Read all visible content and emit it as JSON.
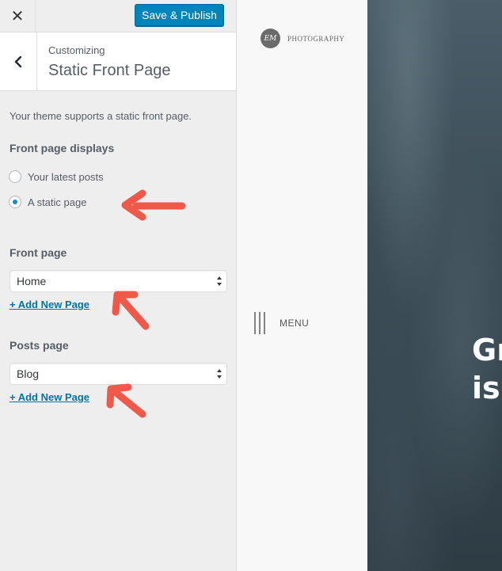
{
  "header": {
    "close_label": "✕",
    "publish_label": "Save & Publish"
  },
  "section": {
    "crumb": "Customizing",
    "title": "Static Front Page"
  },
  "description": "Your theme supports a static front page.",
  "front_page_displays": {
    "title": "Front page displays",
    "options": [
      {
        "label": "Your latest posts",
        "checked": false
      },
      {
        "label": "A static page",
        "checked": true
      }
    ]
  },
  "front_page": {
    "title": "Front page",
    "selected": "Home",
    "add_link": "+ Add New Page"
  },
  "posts_page": {
    "title": "Posts page",
    "selected": "Blog",
    "add_link": "+ Add New Page"
  },
  "preview": {
    "logo_monogram": "EM",
    "logo_text": "PHOTOGRAPHY",
    "menu_label": "MENU",
    "hero_line1": "Gr",
    "hero_line2": "is"
  },
  "colors": {
    "accent": "#0085ba",
    "link": "#0073aa",
    "annotation_arrow": "#f0584a"
  }
}
